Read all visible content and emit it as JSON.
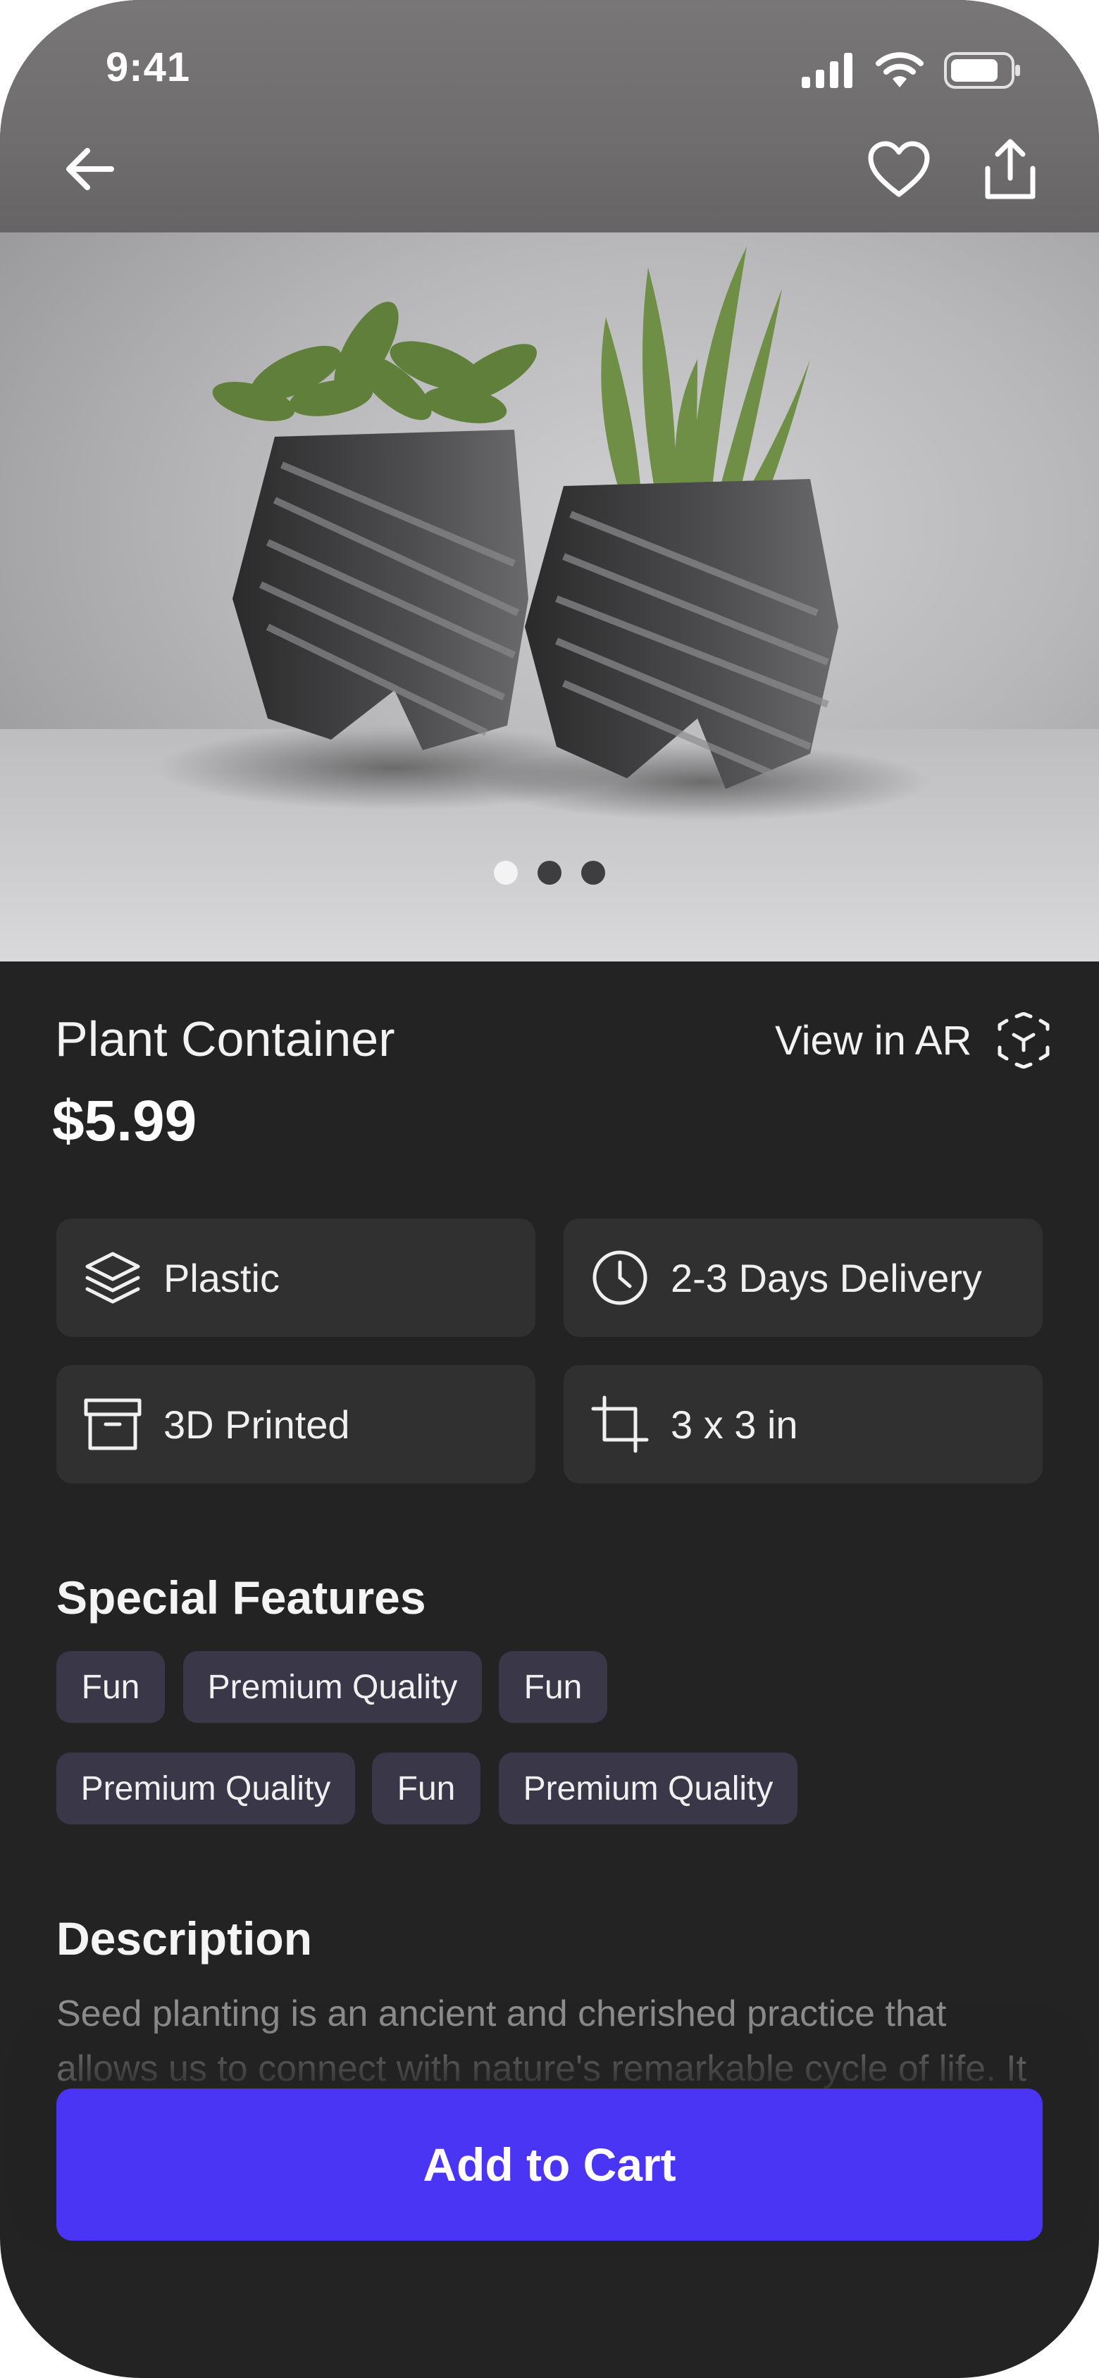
{
  "status_bar": {
    "time": "9:41"
  },
  "header": {
    "icons": {
      "back": "arrow-left-icon",
      "favorite": "heart-icon",
      "share": "share-icon"
    }
  },
  "gallery": {
    "slide_count": 3,
    "active_slide": 1
  },
  "product": {
    "name": "Plant Container",
    "price": "$5.99",
    "ar_label": "View in AR"
  },
  "specs": [
    {
      "icon": "layers-icon",
      "label": "Plastic"
    },
    {
      "icon": "clock-icon",
      "label": "2-3 Days Delivery"
    },
    {
      "icon": "archive-box-icon",
      "label": "3D Printed"
    },
    {
      "icon": "crop-icon",
      "label": "3 x 3 in"
    }
  ],
  "features": {
    "title": "Special Features",
    "tags": [
      "Fun",
      "Premium Quality",
      "Fun",
      "Premium Quality",
      "Fun",
      "Premium Quality"
    ]
  },
  "description": {
    "title": "Description",
    "text": "Seed planting is an ancient and cherished practice that allows us to connect with nature's remarkable cycle of life. It"
  },
  "cta": {
    "label": "Add to Cart"
  },
  "colors": {
    "accent": "#4a35f5",
    "background": "#232323",
    "card": "#303030",
    "tag": "#3a3848"
  }
}
